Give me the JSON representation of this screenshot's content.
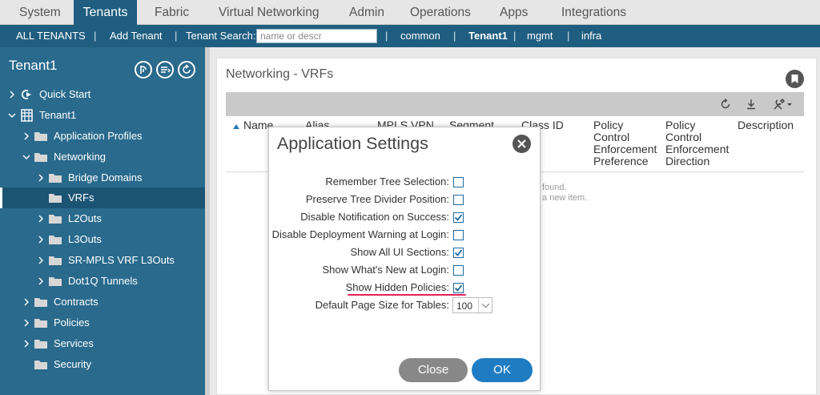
{
  "topnav": {
    "tabs": [
      {
        "label": "System"
      },
      {
        "label": "Tenants"
      },
      {
        "label": "Fabric"
      },
      {
        "label": "Virtual Networking"
      },
      {
        "label": "Admin"
      },
      {
        "label": "Operations"
      },
      {
        "label": "Apps"
      },
      {
        "label": "Integrations"
      }
    ],
    "active_tab": "Tenants"
  },
  "subnav": {
    "all_tenants": "ALL TENANTS",
    "add_tenant": "Add Tenant",
    "search_label": "Tenant Search:",
    "search_placeholder": "name or descr",
    "tenants": [
      "common",
      "Tenant1",
      "mgmt",
      "infra"
    ],
    "separator": "|"
  },
  "sidebar": {
    "title": "Tenant1",
    "tree": [
      {
        "label": "Quick Start",
        "icon": "quick-start-icon",
        "expanded": false
      },
      {
        "label": "Tenant1",
        "icon": "tenant-icon",
        "expanded": true
      },
      {
        "label": "Application Profiles",
        "icon": "folder-icon",
        "expanded": false
      },
      {
        "label": "Networking",
        "icon": "folder-icon",
        "expanded": true
      },
      {
        "label": "Bridge Domains",
        "icon": "folder-icon",
        "expanded": false
      },
      {
        "label": "VRFs",
        "icon": "folder-icon",
        "selected": true
      },
      {
        "label": "L2Outs",
        "icon": "folder-icon",
        "expanded": false
      },
      {
        "label": "L3Outs",
        "icon": "folder-icon",
        "expanded": false
      },
      {
        "label": "SR-MPLS VRF L3Outs",
        "icon": "folder-icon",
        "expanded": false
      },
      {
        "label": "Dot1Q Tunnels",
        "icon": "folder-icon",
        "expanded": false
      },
      {
        "label": "Contracts",
        "icon": "folder-icon",
        "expanded": false
      },
      {
        "label": "Policies",
        "icon": "folder-icon",
        "expanded": false
      },
      {
        "label": "Services",
        "icon": "folder-icon",
        "expanded": false
      },
      {
        "label": "Security",
        "icon": "folder-icon"
      }
    ]
  },
  "main": {
    "title": "Networking - VRFs",
    "columns": {
      "name": "Name",
      "alias": "Alias",
      "mpls": "MPLS VPN",
      "segment": "Segment",
      "class_id": "Class ID",
      "pcep_1": "Policy",
      "pcep_2": "Control",
      "pcep_3": "Enforcement",
      "pcep_4": "Preference",
      "pced_1": "Policy",
      "pced_2": "Control",
      "pced_3": "Enforcement",
      "pced_4": "Direction",
      "description": "Description"
    },
    "empty_line1": "found.",
    "empty_line2": "a new item."
  },
  "modal": {
    "title": "Application Settings",
    "settings": [
      {
        "label": "Remember Tree Selection:",
        "checked": false
      },
      {
        "label": "Preserve Tree Divider Position:",
        "checked": false
      },
      {
        "label": "Disable Notification on Success:",
        "checked": true
      },
      {
        "label": "Disable Deployment Warning at Login:",
        "checked": false
      },
      {
        "label": "Show All UI Sections:",
        "checked": true
      },
      {
        "label": "Show What's New at Login:",
        "checked": false
      },
      {
        "label": "Show Hidden Policies:",
        "checked": true
      }
    ],
    "page_size_label": "Default Page Size for Tables:",
    "page_size_value": "100",
    "close_label": "Close",
    "ok_label": "OK"
  },
  "colors": {
    "brand": "#1f5e80",
    "sidebar": "#296a8d",
    "checkbox": "#1f6aa0",
    "highlight_underline": "#e0235a",
    "ok_button": "#1f7cc3"
  }
}
